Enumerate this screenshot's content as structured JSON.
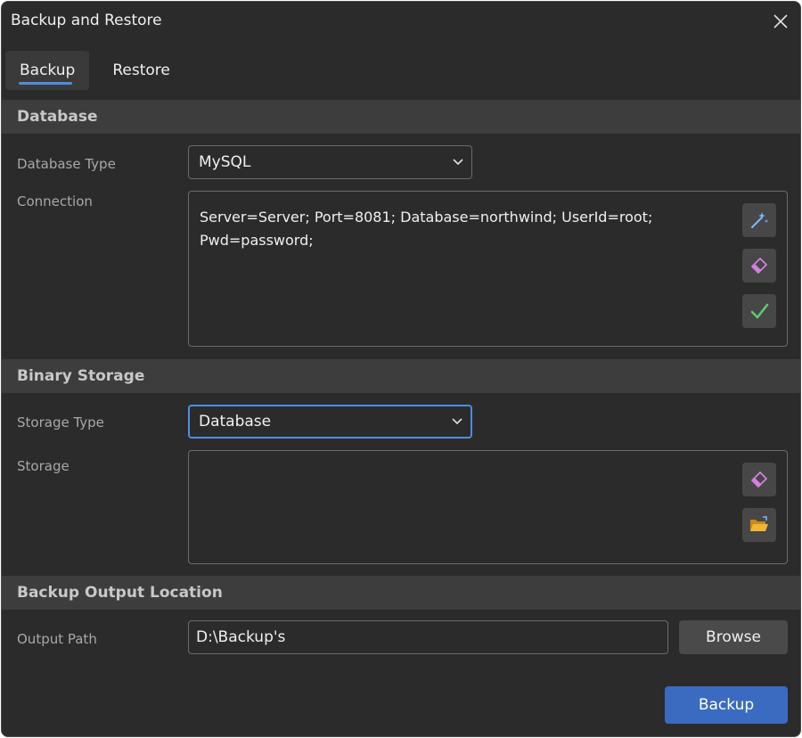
{
  "window": {
    "title": "Backup and Restore"
  },
  "tabs": [
    {
      "label": "Backup",
      "active": true
    },
    {
      "label": "Restore",
      "active": false
    }
  ],
  "database": {
    "header": "Database",
    "type_label": "Database Type",
    "type_value": "MySQL",
    "connection_label": "Connection",
    "connection_line1": "Server=Server; Port=8081; Database=northwind; UserId=root;",
    "connection_line2": "Pwd=password;",
    "icons": [
      "magic-wand-icon",
      "eraser-icon",
      "checkmark-icon"
    ]
  },
  "binary_storage": {
    "header": "Binary Storage",
    "type_label": "Storage Type",
    "type_value": "Database",
    "storage_label": "Storage",
    "storage_value": "",
    "icons": [
      "eraser-icon",
      "folder-open-icon"
    ]
  },
  "output": {
    "header": "Backup Output Location",
    "path_label": "Output Path",
    "path_value": "D:\\Backup's",
    "browse_label": "Browse"
  },
  "actions": {
    "backup_label": "Backup"
  },
  "colors": {
    "accent": "#4e8ee3",
    "primary_button": "#3b6bc0",
    "background": "#2b2b2b",
    "section_header": "#3d3d3d"
  }
}
